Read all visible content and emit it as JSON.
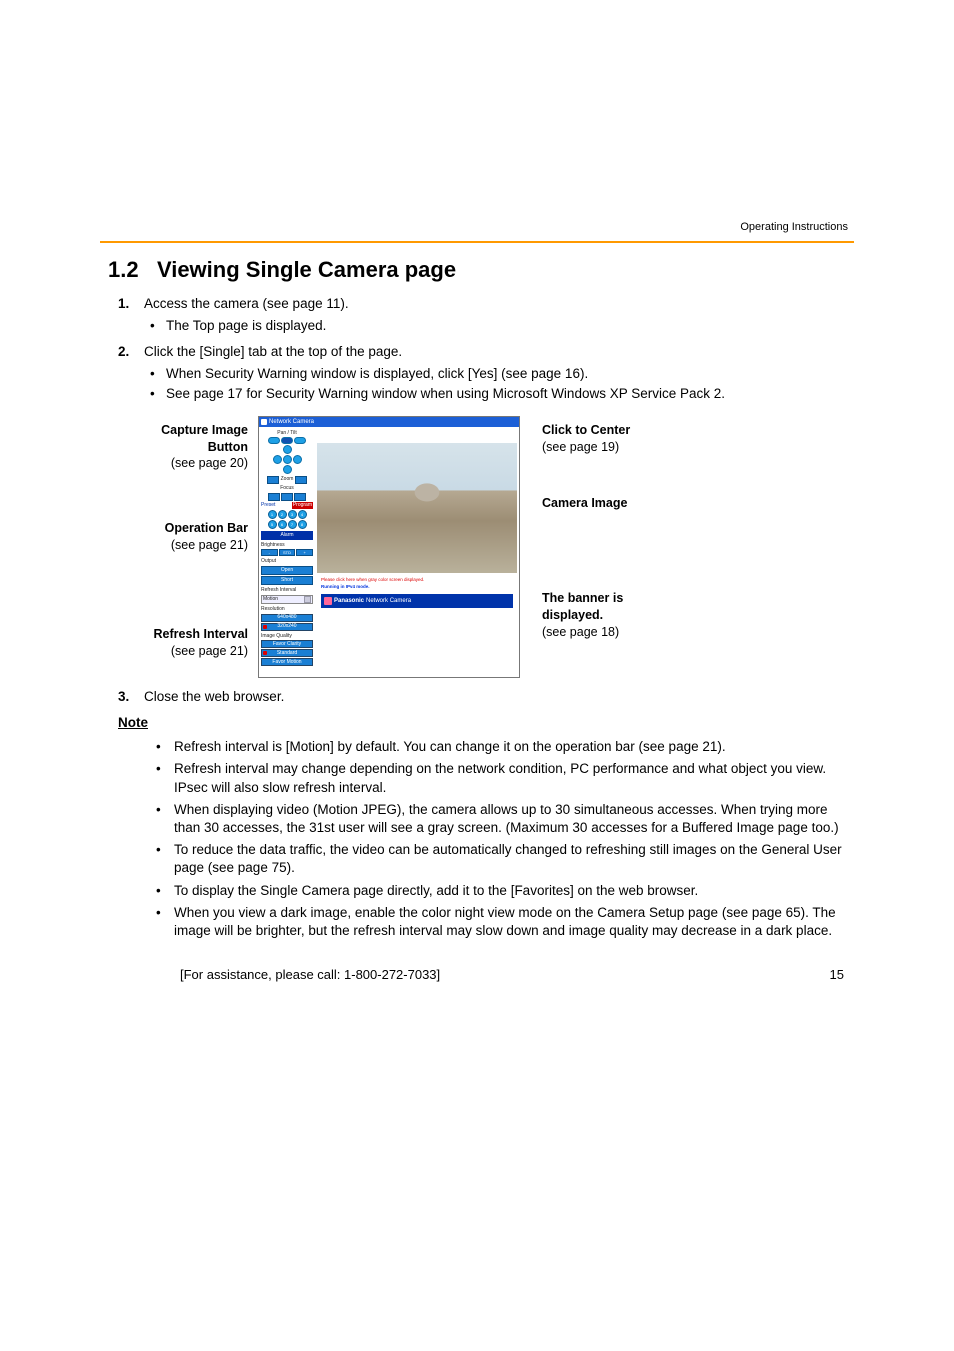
{
  "header": {
    "running": "Operating Instructions"
  },
  "section": {
    "number": "1.2",
    "title": "Viewing Single Camera page"
  },
  "steps": [
    {
      "num": "1.",
      "text": "Access the camera (see page 11).",
      "subs": [
        "The Top page is displayed."
      ]
    },
    {
      "num": "2.",
      "text": "Click the [Single] tab at the top of the page.",
      "subs": [
        "When Security Warning window is displayed, click [Yes] (see page 16).",
        "See page 17 for Security Warning window when using Microsoft Windows XP Service Pack 2."
      ]
    }
  ],
  "step3": {
    "num": "3.",
    "text": "Close the web browser."
  },
  "callouts": {
    "left": [
      {
        "title": "Capture Image Button",
        "ref": "(see page 20)"
      },
      {
        "title": "Operation Bar",
        "ref": "(see page 21)"
      },
      {
        "title": "Refresh Interval",
        "ref": "(see page 21)"
      }
    ],
    "right": [
      {
        "title": "Click to Center",
        "ref": "(see page 19)"
      },
      {
        "title": "Camera Image",
        "ref": ""
      },
      {
        "title": "The banner is displayed.",
        "ref": "(see page 18)"
      }
    ]
  },
  "app": {
    "title": "Network Camera",
    "sidebar": {
      "pantilt": "Pan / Tilt",
      "scan": "Scan",
      "zoom": "Zoom",
      "focus": "Focus",
      "af": "AF",
      "preset": "Preset",
      "program": "Program",
      "alarm": "Alarm",
      "brightness": "Brightness",
      "std": "STD",
      "output": "Output",
      "open": "Open",
      "short": "Short",
      "refresh": "Refresh Interval",
      "motion": "Motion",
      "resolution": "Resolution",
      "res1": "640x480",
      "res2": "320x240",
      "imgq": "Image Quality",
      "fc": "Favor Clarity",
      "std2": "Standard",
      "fm": "Favor Motion"
    },
    "main": {
      "red": "Please click here when gray color screen displayed.",
      "blue": "Running in IPv4 mode.",
      "banner_brand": "Panasonic",
      "banner_text": "Network Camera"
    }
  },
  "note": {
    "heading": "Note",
    "items": [
      "Refresh interval is [Motion] by default. You can change it on the operation bar (see page 21).",
      "Refresh interval may change depending on the network condition, PC performance and what object you view. IPsec will also slow refresh interval.",
      "When displaying video (Motion JPEG), the camera allows up to 30 simultaneous accesses. When trying more than 30 accesses, the 31st user will see a gray screen. (Maximum 30 accesses for a Buffered Image page too.)",
      "To reduce the data traffic, the video can be automatically changed to refreshing still images on the General User page (see page 75).",
      "To display the Single Camera page directly, add it to the [Favorites] on the web browser.",
      "When you view a dark image, enable the color night view mode on the Camera Setup page (see page 65). The image will be brighter, but the refresh interval may slow down and image quality may decrease in a dark place."
    ]
  },
  "footer": {
    "assist": "[For assistance, please call: 1-800-272-7033]",
    "page": "15"
  }
}
